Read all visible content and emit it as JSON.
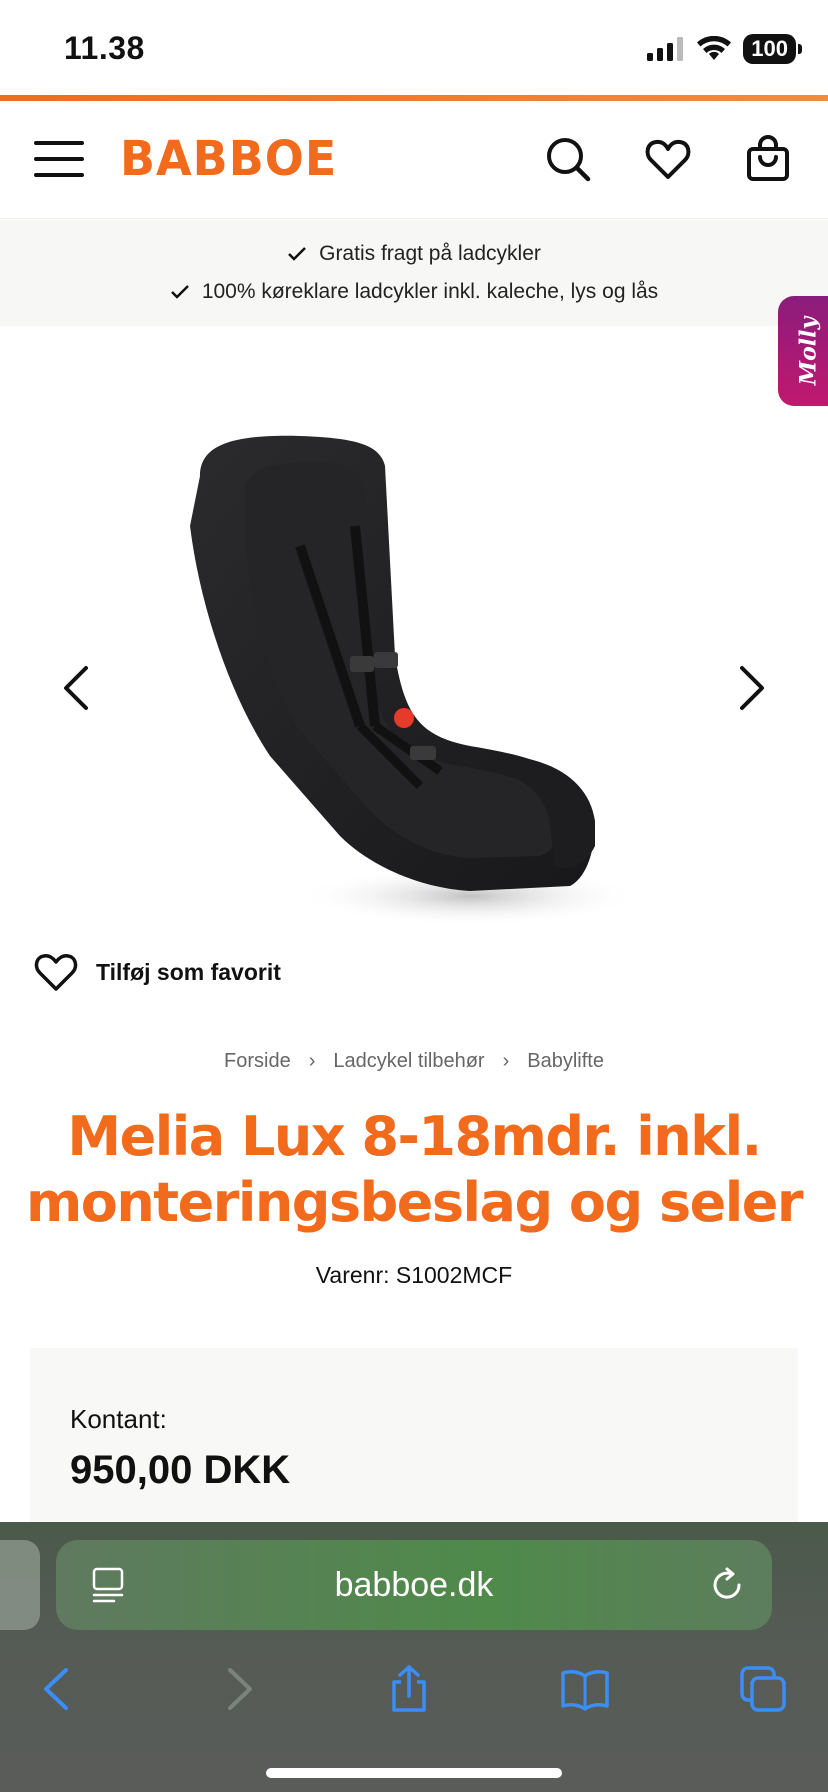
{
  "status_bar": {
    "time": "11.38",
    "battery": "100"
  },
  "header": {
    "logo": "BABBOE",
    "icons": [
      "menu-icon",
      "search-icon",
      "heart-icon",
      "cart-icon"
    ]
  },
  "usp": {
    "line1": "Gratis fragt på ladcykler",
    "line2": "100% køreklare ladcykler inkl. kaleche, lys og lås"
  },
  "molly_tab": {
    "label": "Molly"
  },
  "favorite": {
    "label": "Tilføj som favorit"
  },
  "breadcrumb": {
    "items": [
      "Forside",
      "Ladcykel tilbehør",
      "Babylifte"
    ]
  },
  "product": {
    "title": "Melia Lux 8-18mdr. inkl. monteringsbeslag og seler",
    "sku": "Varenr: S1002MCF",
    "price_label": "Kontant:",
    "price": "950,00 DKK"
  },
  "browser": {
    "url": "babboe.dk"
  },
  "colors": {
    "brand_orange": "#f26a1b",
    "molly_magenta": "#b5177a",
    "ios_blue": "#3a8ef6"
  }
}
